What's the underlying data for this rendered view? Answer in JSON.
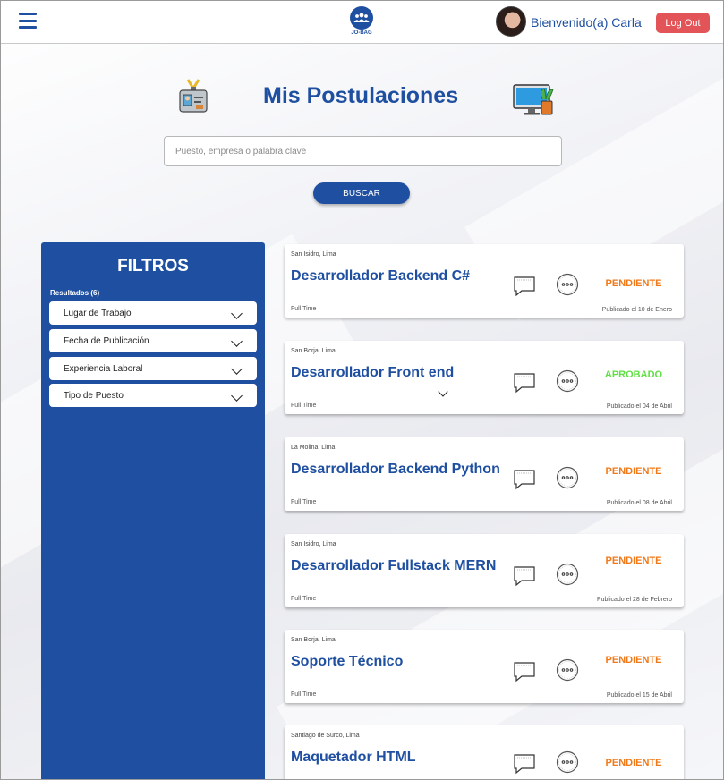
{
  "header": {
    "logo_text": "JO-BAG",
    "welcome": "Bienvenido(a) Carla",
    "logout_label": "Log Out"
  },
  "page": {
    "title": "Mis Postulaciones",
    "search_placeholder": "Puesto, empresa o palabra clave",
    "search_button": "BUSCAR"
  },
  "filters": {
    "title": "FILTROS",
    "results": "Resultados (6)",
    "items": [
      {
        "label": "Lugar de Trabajo"
      },
      {
        "label": "Fecha de Publicación"
      },
      {
        "label": "Experiencia Laboral"
      },
      {
        "label": "Tipo de Puesto"
      }
    ]
  },
  "jobs": [
    {
      "location": "San Isidro, Lima",
      "title": "Desarrollador Backend C#",
      "type": "Full Time",
      "published": "Publicado el 10 de Enero",
      "status": "PENDIENTE"
    },
    {
      "location": "San Borja, Lima",
      "title": "Desarrollador Front end",
      "type": "Full Time",
      "published": "Publicado el 04 de Abril",
      "status": "APROBADO"
    },
    {
      "location": "La Molina, Lima",
      "title": "Desarrollador Backend Python",
      "type": "Full Time",
      "published": "Publicado el 08 de Abril",
      "status": "PENDIENTE"
    },
    {
      "location": "San Isidro, Lima",
      "title": "Desarrollador Fullstack MERN",
      "type": "Full Time",
      "published": "Publicado el 28 de Febrero",
      "status": "PENDIENTE"
    },
    {
      "location": "San Borja, Lima",
      "title": "Soporte Técnico",
      "type": "Full Time",
      "published": "Publicado el 15 de Abril",
      "status": "PENDIENTE"
    },
    {
      "location": "Santiago de Surco, Lima",
      "title": "Maquetador HTML",
      "type": "",
      "published": "",
      "status": "PENDIENTE"
    }
  ],
  "colors": {
    "brand": "#1f4fa0",
    "pending": "#f07a1a",
    "approved": "#5fe043",
    "logout": "#e25457"
  }
}
